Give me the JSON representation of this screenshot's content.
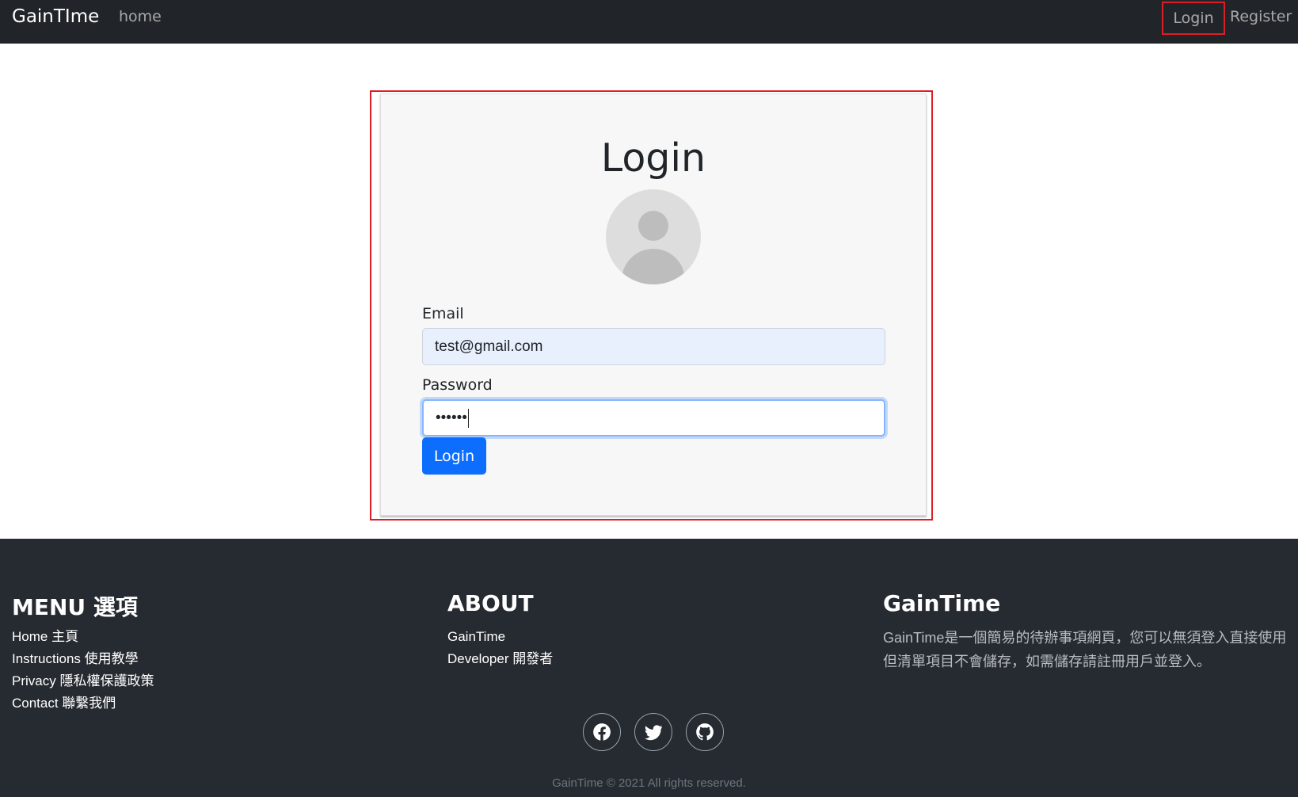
{
  "navbar": {
    "brand": "GainTIme",
    "home": "home",
    "login": "Login",
    "register": "Register"
  },
  "login_card": {
    "title": "Login",
    "email_label": "Email",
    "email_value": "test@gmail.com",
    "password_label": "Password",
    "password_value": "••••••",
    "submit_label": "Login"
  },
  "footer": {
    "menu": {
      "title": "MENU 選項",
      "items": [
        "Home 主頁",
        "Instructions 使用教學",
        "Privacy 隱私權保護政策",
        "Contact 聯繫我們"
      ]
    },
    "about": {
      "title": "ABOUT",
      "items": [
        "GainTime",
        "Developer 開發者"
      ]
    },
    "gaintime": {
      "title": "GainTime",
      "description": "GainTime是一個簡易的待辦事項網頁，您可以無須登入直接使用但清單項目不會儲存，如需儲存請註冊用戶並登入。"
    },
    "social_icons": [
      "facebook-icon",
      "twitter-icon",
      "github-icon"
    ],
    "copyright": "GainTime © 2021 All rights reserved."
  },
  "colors": {
    "navbar_bg": "#212529",
    "footer_bg": "#262b31",
    "primary": "#0d6efd",
    "highlight": "#dc1f26"
  }
}
